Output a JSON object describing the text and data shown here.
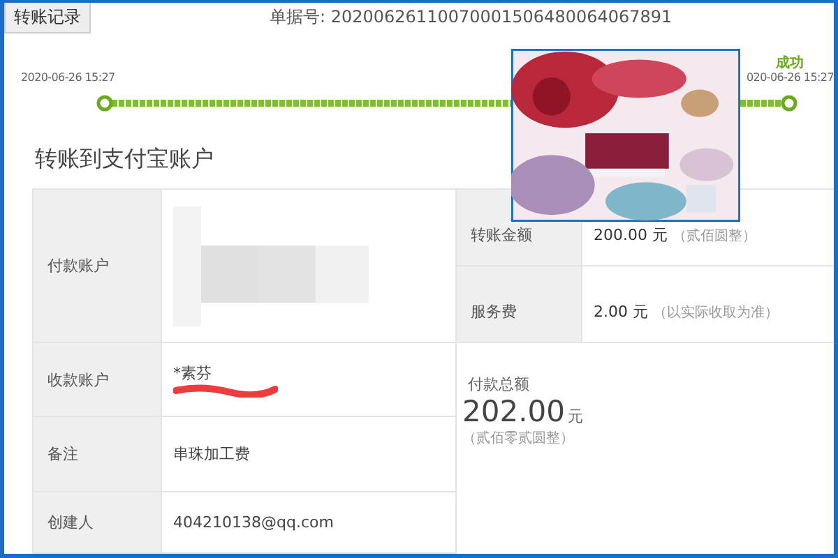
{
  "tab": {
    "label": "转账记录",
    "selected": true
  },
  "receipt_number": "单据号: 20200626110070001506480064067891",
  "steps": [
    {
      "time": "2020-06-26 15:27"
    },
    {
      "label": "成功",
      "time": "020-06-26 15:27"
    }
  ],
  "title": "转账到支付宝账户",
  "left_rows": [
    {
      "label": "付款账户",
      "kind": "mosaic"
    },
    {
      "label": "收款账户",
      "kind": "scribble",
      "value": "*素芬"
    },
    {
      "label": "备注",
      "kind": "text",
      "value": "串珠加工费"
    },
    {
      "label": "创建人",
      "kind": "text",
      "value": "404210138@qq.com"
    }
  ],
  "right_rows": [
    {
      "label": "转账金额",
      "amount": "200.00",
      "unit": "元",
      "note": "（贰佰圆整）"
    },
    {
      "label": "服务费",
      "amount": "2.00",
      "unit": "元",
      "note": "（以实际收取为准）"
    }
  ],
  "total": {
    "label": "付款总额",
    "amount": "202.00",
    "unit": "元",
    "note": "（贰佰零贰圆整）"
  }
}
